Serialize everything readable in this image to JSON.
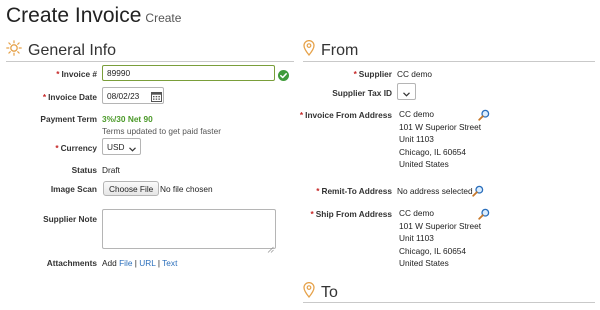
{
  "page": {
    "title": "Create Invoice",
    "subtitle": "Create"
  },
  "general_info": {
    "heading": "General Info",
    "invoice_number": {
      "label": "Invoice #",
      "value": "89990"
    },
    "invoice_date": {
      "label": "Invoice Date",
      "value": "08/02/23"
    },
    "payment_term": {
      "label": "Payment Term",
      "value": "3%/30 Net 90",
      "note": "Terms updated to get paid faster"
    },
    "currency": {
      "label": "Currency",
      "value": "USD"
    },
    "status": {
      "label": "Status",
      "value": "Draft"
    },
    "image_scan": {
      "label": "Image Scan",
      "button": "Choose File",
      "file_text": "No file chosen"
    },
    "supplier_note": {
      "label": "Supplier Note",
      "value": ""
    },
    "attachments": {
      "label": "Attachments",
      "prefix": "Add",
      "links": [
        "File",
        "URL",
        "Text"
      ],
      "separator": "|"
    }
  },
  "from": {
    "heading": "From",
    "supplier": {
      "label": "Supplier",
      "value": "CC demo"
    },
    "supplier_tax_id": {
      "label": "Supplier Tax ID"
    },
    "invoice_from_address": {
      "label": "Invoice From Address",
      "lines": [
        "CC demo",
        "101 W Superior Street",
        "Unit 1103",
        "Chicago, IL 60654",
        "United States"
      ]
    },
    "remit_to_address": {
      "label": "Remit-To Address",
      "value": "No address selected"
    },
    "ship_from_address": {
      "label": "Ship From Address",
      "lines": [
        "CC demo",
        "101 W Superior Street",
        "Unit 1103",
        "Chicago, IL 60654",
        "United States"
      ]
    }
  },
  "to": {
    "heading": "To"
  },
  "colors": {
    "accent_icon": "#e6a24a",
    "valid_green": "#3f9b3a",
    "link": "#2a6ebb",
    "required": "#c62828"
  }
}
